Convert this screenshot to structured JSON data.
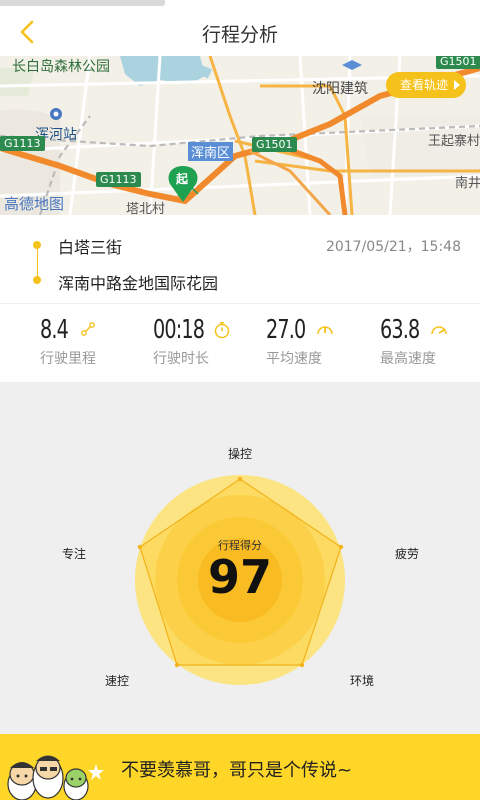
{
  "header": {
    "title": "行程分析"
  },
  "map": {
    "labels": {
      "park": "长白岛森林公园",
      "station": "浑河站",
      "district": "浑南区",
      "city_area": "沈阳建筑",
      "village": "王起寨村",
      "south": "南井",
      "tower": "塔北村",
      "brand": "高德地图",
      "start_pin": "起"
    },
    "roads": [
      "G1501",
      "G1113",
      "G1113",
      "G1501"
    ],
    "view_track_label": "查看轨迹"
  },
  "route": {
    "from": "白塔三街",
    "to": "浑南中路金地国际花园",
    "datetime": "2017/05/21，15:48"
  },
  "stats": [
    {
      "value": "8.4",
      "label": "行驶里程",
      "icon": "route-icon"
    },
    {
      "value": "00:18",
      "label": "行驶时长",
      "icon": "stopwatch-icon"
    },
    {
      "value": "27.0",
      "label": "平均速度",
      "icon": "speedometer-icon"
    },
    {
      "value": "63.8",
      "label": "最高速度",
      "icon": "speed-gauge-icon"
    }
  ],
  "score": {
    "title": "行程得分",
    "value": "97",
    "dimensions": [
      "操控",
      "疲劳",
      "环境",
      "速控",
      "专注"
    ]
  },
  "banner": {
    "slogan": "不要羡慕哥，哥只是个传说~"
  },
  "colors": {
    "accent": "#f5c21b",
    "banner": "#fdd628",
    "route": "#f08a2c",
    "pin": "#1fa152"
  }
}
